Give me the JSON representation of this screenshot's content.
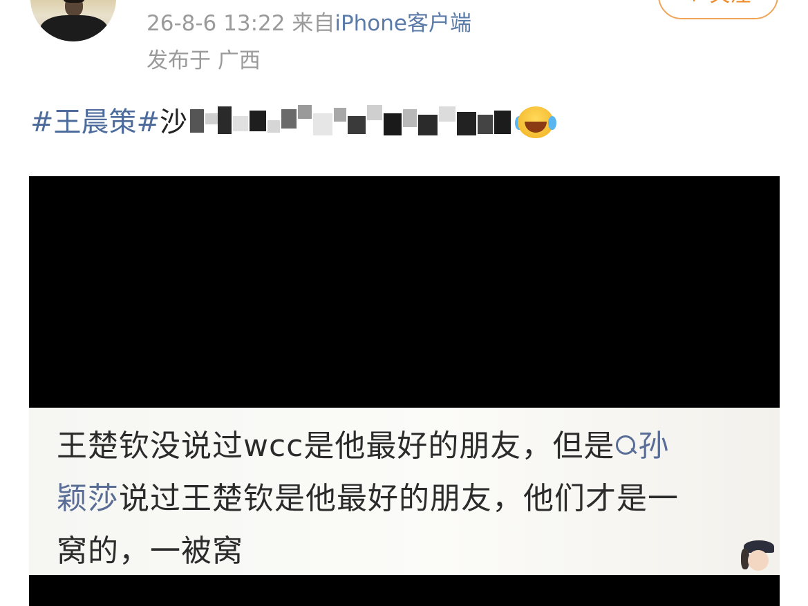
{
  "post_header": {
    "follow_label": "+ 关注",
    "timestamp": "26-8-6 13:22",
    "source_prefix": "来自",
    "source_client": "iPhone客户端",
    "location": "发布于 广西"
  },
  "post": {
    "hashtag": "#王晨策#",
    "text_visible": "沙"
  },
  "video_caption": {
    "line1_before": "王楚钦没说过wcc是他最好的朋友，但是",
    "search_name_part1": "孙",
    "search_name_part2": "颖莎",
    "line2_after": "说过王楚钦是他最好的朋友，他们才是一",
    "line3": "窝的，一被窝"
  },
  "icons": {
    "avatar": "user-avatar",
    "emoji": "laugh-cry-emoji-icon",
    "search": "search-icon"
  },
  "colors": {
    "hashtag": "#4d6c9c",
    "follow": "#ee8c2b",
    "meta": "#9a9a9a",
    "link": "#5a6d96"
  }
}
